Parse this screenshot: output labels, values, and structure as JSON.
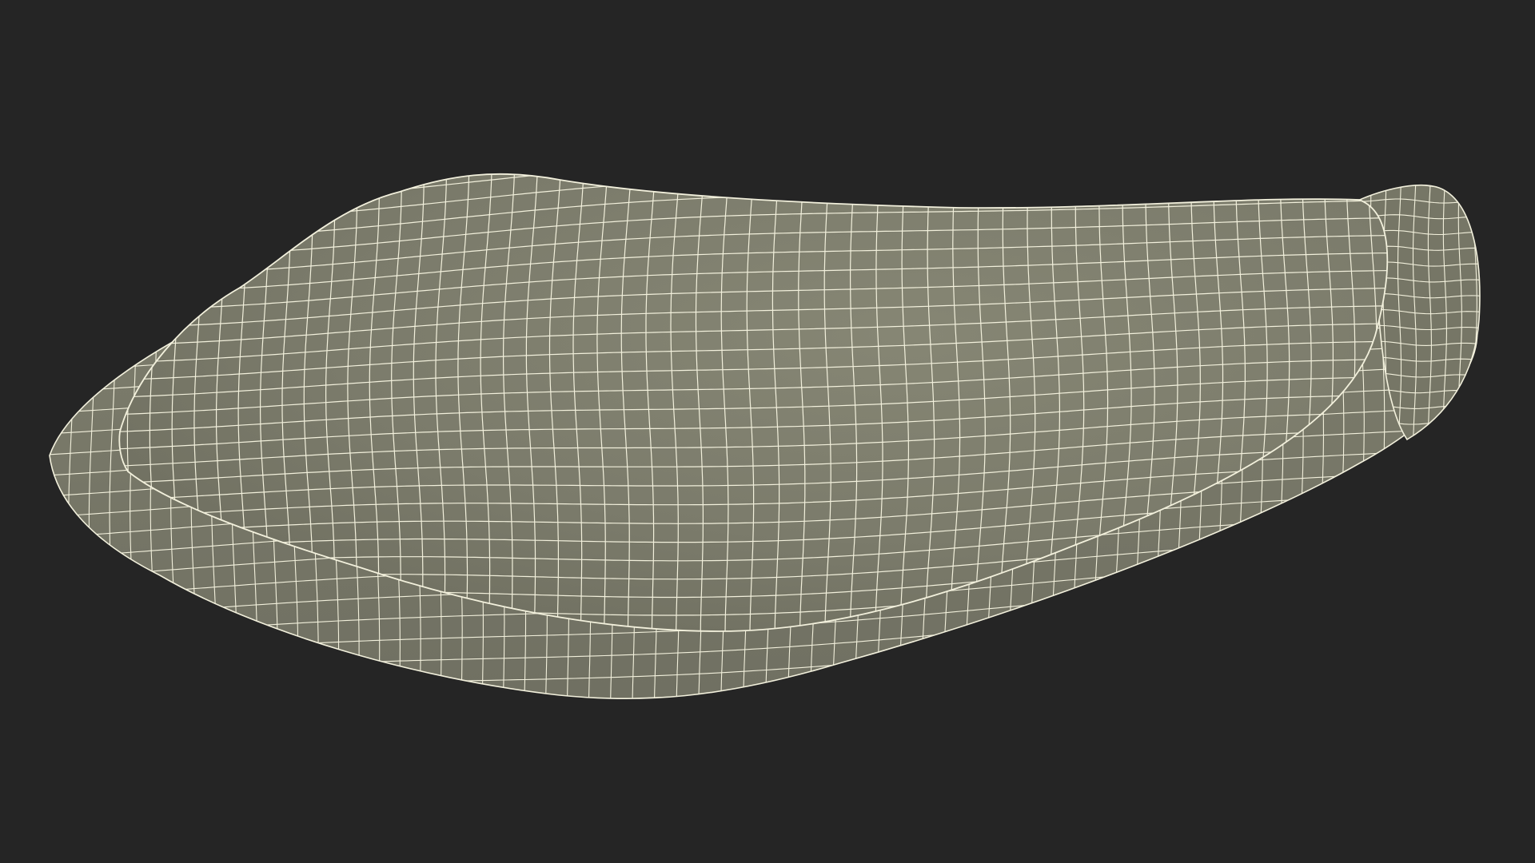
{
  "scene": {
    "subject": "wireframe-3d-mesh-shell",
    "colors": {
      "background": "#252525",
      "mesh_fill": "#7b7b6b",
      "mesh_fill_dark": "#6f6f60",
      "mesh_fill_light": "#868674",
      "wire": "#f2f0dc"
    }
  }
}
